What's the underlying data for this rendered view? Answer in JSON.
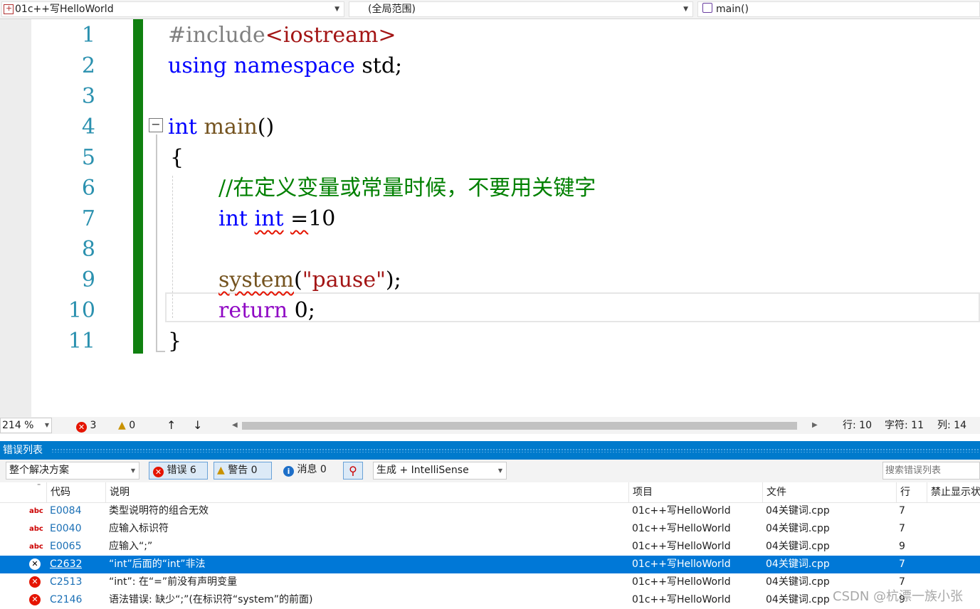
{
  "nav": {
    "project_dd": "01c++写HelloWorld",
    "scope_dd": "(全局范围)",
    "member_dd": "main()"
  },
  "editor": {
    "line_numbers": [
      "1",
      "2",
      "3",
      "4",
      "5",
      "6",
      "7",
      "8",
      "9",
      "10",
      "11"
    ],
    "lines": {
      "l1_pp": "#include",
      "l1_str": "<iostream>",
      "l2_kw1": "using",
      "l2_kw2": "namespace",
      "l2_rest": " std;",
      "l4_kw": "int",
      "l4_fn": " main",
      "l4_rest": "()",
      "l5": "{",
      "l6_cm": "//在定义变量或常量时候，不要用关键字",
      "l7_kw1": "int",
      "l7_kw2": "int",
      "l7_eq": "=",
      "l7_num": "10",
      "l9_fn": "system",
      "l9_p1": "(",
      "l9_str": "\"pause\"",
      "l9_p2": ");",
      "l10_kw": "return",
      "l10_rest": " 0;",
      "l11": "}"
    },
    "collapse_glyph": "−"
  },
  "status": {
    "zoom": "214 %",
    "errors": "3",
    "warnings": "0",
    "up": "↑",
    "down": "↓",
    "row": "行: 10",
    "char": "字符: 11",
    "col": "列: 14"
  },
  "errorlist": {
    "title": "错误列表",
    "scope_dd": "整个解决方案",
    "errors_btn": "错误 6",
    "warnings_btn": "警告 0",
    "messages_btn": "消息 0",
    "build_dd": "生成 + IntelliSense",
    "search_placeholder": "搜索错误列表",
    "headers": {
      "code": "代码",
      "desc": "说明",
      "project": "项目",
      "file": "文件",
      "line": "行",
      "suppress": "禁止显示状"
    },
    "rows": [
      {
        "code": "E0084",
        "desc": "类型说明符的组合无效",
        "project": "01c++写HelloWorld",
        "file": "04关键词.cpp",
        "line": "7"
      },
      {
        "code": "E0040",
        "desc": "应输入标识符",
        "project": "01c++写HelloWorld",
        "file": "04关键词.cpp",
        "line": "7"
      },
      {
        "code": "E0065",
        "desc": "应输入“;”",
        "project": "01c++写HelloWorld",
        "file": "04关键词.cpp",
        "line": "9"
      },
      {
        "code": "C2632",
        "desc": "“int”后面的“int”非法",
        "project": "01c++写HelloWorld",
        "file": "04关键词.cpp",
        "line": "7"
      },
      {
        "code": "C2513",
        "desc": "“int”: 在“=”前没有声明变量",
        "project": "01c++写HelloWorld",
        "file": "04关键词.cpp",
        "line": "7"
      },
      {
        "code": "C2146",
        "desc": "语法错误: 缺少“;”(在标识符“system”的前面)",
        "project": "01c++写HelloWorld",
        "file": "04关键词.cpp",
        "line": "9"
      }
    ]
  },
  "watermark": "CSDN @杭漂一族小张",
  "colors": {
    "accent": "#007acc",
    "selected": "#0078d7",
    "error": "#e51400",
    "warning": "#f0b000",
    "info": "#1e6fc8",
    "gutter_change": "#108010"
  }
}
